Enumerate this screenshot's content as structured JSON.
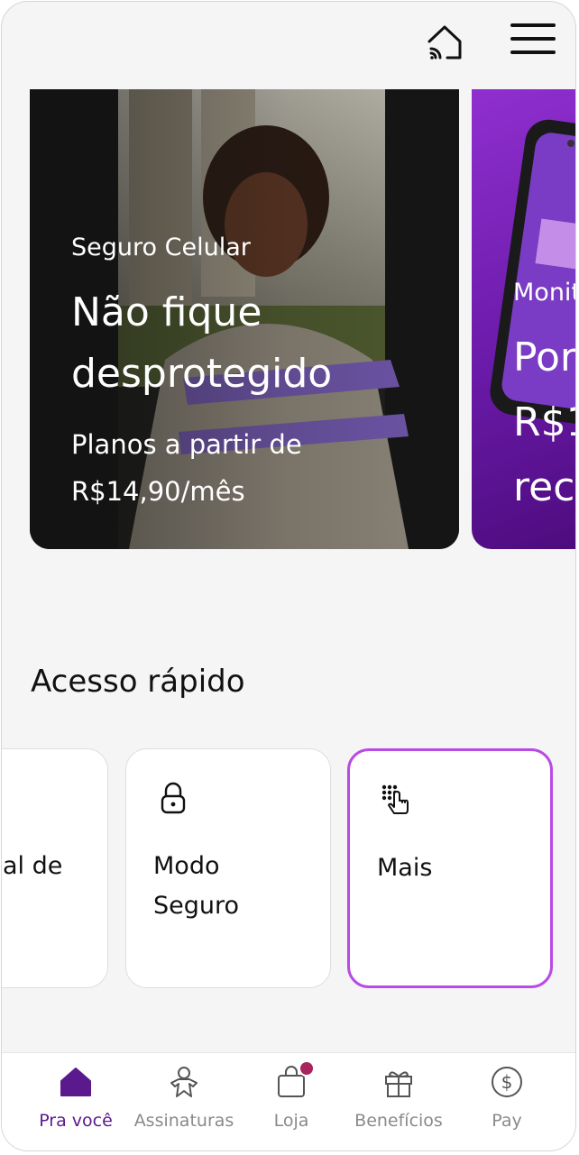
{
  "header": {
    "home_icon": "home-wifi-icon",
    "menu_icon": "hamburger-menu-icon"
  },
  "carousel": {
    "banners": [
      {
        "eyebrow": "Seguro Celular",
        "title_lines": [
          "Não fique",
          "desprotegido"
        ],
        "subtitle_lines": [
          "Planos a partir de",
          "R$14,90/mês"
        ]
      },
      {
        "eyebrow": "Monit",
        "title_lines": [
          "Por",
          "R$1",
          "rec"
        ]
      }
    ]
  },
  "quick_access": {
    "title": "Acesso rápido",
    "cards": [
      {
        "label": "al de",
        "icon": ""
      },
      {
        "label_lines": [
          "Modo",
          "Seguro"
        ],
        "icon": "lock-icon"
      },
      {
        "label": "Mais",
        "icon": "keypad-pointer-icon"
      }
    ],
    "highlight_color": "#b94ae6"
  },
  "bottom_nav": {
    "items": [
      {
        "label": "Pra você",
        "icon": "home-icon",
        "active": true
      },
      {
        "label": "Assinaturas",
        "icon": "person-star-icon",
        "active": false
      },
      {
        "label": "Loja",
        "icon": "shopping-bag-icon",
        "active": false,
        "badge": true
      },
      {
        "label": "Benefícios",
        "icon": "gift-icon",
        "active": false
      },
      {
        "label": "Pay",
        "icon": "dollar-coin-icon",
        "active": false
      }
    ],
    "active_color": "#5a1a8e",
    "inactive_color": "#8a8a8a",
    "badge_color": "#a8245c"
  }
}
